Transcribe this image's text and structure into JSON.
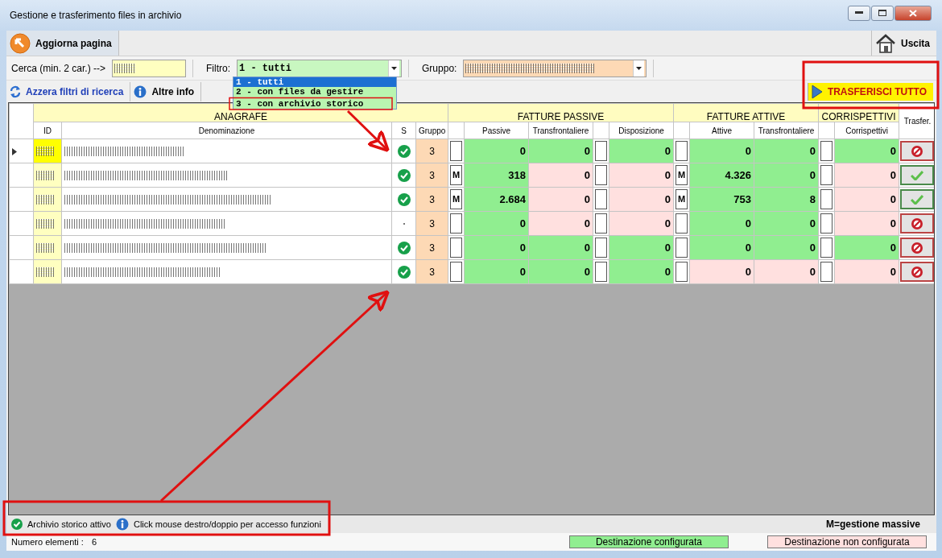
{
  "window": {
    "title": "Gestione e trasferimento files in archivio"
  },
  "toolbar": {
    "refresh": "Aggiorna pagina",
    "exit": "Uscita"
  },
  "filters": {
    "search_label": "Cerca  (min. 2 car.) -->",
    "filter_label": "Filtro:",
    "filter_value": "1 - tutti",
    "filter_options": [
      {
        "label": "1 - tutti",
        "selected": true
      },
      {
        "label": "2 - con files da gestire",
        "selected": false
      },
      {
        "label": "3 - con archivio storico",
        "selected": false
      }
    ],
    "group_label": "Gruppo:"
  },
  "actions": {
    "reset": "Azzera filtri di ricerca",
    "info": "Altre info",
    "transfer_all": "TRASFERISCI TUTTO"
  },
  "table": {
    "groups": [
      {
        "kind": "lead",
        "columns": [
          {
            "kind": "pointer"
          }
        ]
      },
      {
        "kind": "group",
        "label": "ANAGRAFE",
        "columns": [
          {
            "kind": "id",
            "label": "ID"
          },
          {
            "kind": "name",
            "label": "Denominazione"
          },
          {
            "kind": "archive",
            "label": "S"
          },
          {
            "kind": "group",
            "label": "Gruppo"
          }
        ]
      },
      {
        "kind": "group",
        "label": "FATTURE PASSIVE",
        "columns": [
          {
            "kind": "mark"
          },
          {
            "kind": "value",
            "label": "Passive"
          },
          {
            "kind": "value",
            "label": "Transfrontaliere"
          },
          {
            "kind": "flag"
          },
          {
            "kind": "value",
            "label": "Disposizione"
          }
        ]
      },
      {
        "kind": "group",
        "label": "FATTURE ATTIVE",
        "columns": [
          {
            "kind": "mark"
          },
          {
            "kind": "value",
            "label": "Attive"
          },
          {
            "kind": "value",
            "label": "Transfrontaliere"
          }
        ]
      },
      {
        "kind": "group",
        "label": "CORRISPETTIVI",
        "columns": [
          {
            "kind": "flag"
          },
          {
            "kind": "value",
            "label": "Corrispettivi"
          }
        ]
      },
      {
        "kind": "single",
        "columns": [
          {
            "kind": "transfer",
            "label": "Trasfer."
          }
        ]
      }
    ],
    "rows": [
      {
        "current": true,
        "selected": true,
        "archive": true,
        "group": "3",
        "values": [
          {
            "value": "0",
            "configured": true
          },
          {
            "value": "0",
            "configured": true
          },
          {
            "value": "0",
            "configured": true
          },
          {
            "value": "0",
            "configured": true
          },
          {
            "value": "0",
            "configured": true
          },
          {
            "value": "0",
            "configured": true
          }
        ],
        "transfer_allowed": false
      },
      {
        "current": false,
        "selected": false,
        "archive": true,
        "group": "3",
        "passive_mark": "M",
        "active_mark": "M",
        "values": [
          {
            "value": "318",
            "configured": true
          },
          {
            "value": "0",
            "configured": false
          },
          {
            "value": "0",
            "configured": false
          },
          {
            "value": "4.326",
            "configured": true
          },
          {
            "value": "0",
            "configured": true
          },
          {
            "value": "0",
            "configured": false
          }
        ],
        "transfer_allowed": true
      },
      {
        "current": false,
        "selected": false,
        "archive": true,
        "group": "3",
        "passive_mark": "M",
        "active_mark": "M",
        "values": [
          {
            "value": "2.684",
            "configured": true
          },
          {
            "value": "0",
            "configured": false
          },
          {
            "value": "0",
            "configured": false
          },
          {
            "value": "753",
            "configured": true
          },
          {
            "value": "8",
            "configured": true
          },
          {
            "value": "0",
            "configured": false
          }
        ],
        "transfer_allowed": true
      },
      {
        "current": false,
        "selected": false,
        "archive": false,
        "group": "3",
        "values": [
          {
            "value": "0",
            "configured": true
          },
          {
            "value": "0",
            "configured": false
          },
          {
            "value": "0",
            "configured": false
          },
          {
            "value": "0",
            "configured": true
          },
          {
            "value": "0",
            "configured": true
          },
          {
            "value": "0",
            "configured": false
          }
        ],
        "transfer_allowed": false
      },
      {
        "current": false,
        "selected": false,
        "archive": true,
        "group": "3",
        "values": [
          {
            "value": "0",
            "configured": true
          },
          {
            "value": "0",
            "configured": true
          },
          {
            "value": "0",
            "configured": true
          },
          {
            "value": "0",
            "configured": true
          },
          {
            "value": "0",
            "configured": true
          },
          {
            "value": "0",
            "configured": true
          }
        ],
        "transfer_allowed": false
      },
      {
        "current": false,
        "selected": false,
        "archive": true,
        "group": "3",
        "values": [
          {
            "value": "0",
            "configured": true
          },
          {
            "value": "0",
            "configured": true
          },
          {
            "value": "0",
            "configured": true
          },
          {
            "value": "0",
            "configured": false
          },
          {
            "value": "0",
            "configured": false
          },
          {
            "value": "0",
            "configured": false
          }
        ],
        "transfer_allowed": false
      }
    ]
  },
  "legend": [
    {
      "kind": "check",
      "text": "Archivio storico attivo"
    },
    {
      "kind": "info",
      "text": "Click mouse destro/doppio per accesso funzioni"
    }
  ],
  "legend_note": "M=gestione massive",
  "status": {
    "label": "Numero elementi :",
    "value": "6",
    "keys": [
      {
        "label": "Destinazione configurata",
        "configured": true
      },
      {
        "label": "Destinazione non configurata",
        "configured": false
      }
    ]
  }
}
